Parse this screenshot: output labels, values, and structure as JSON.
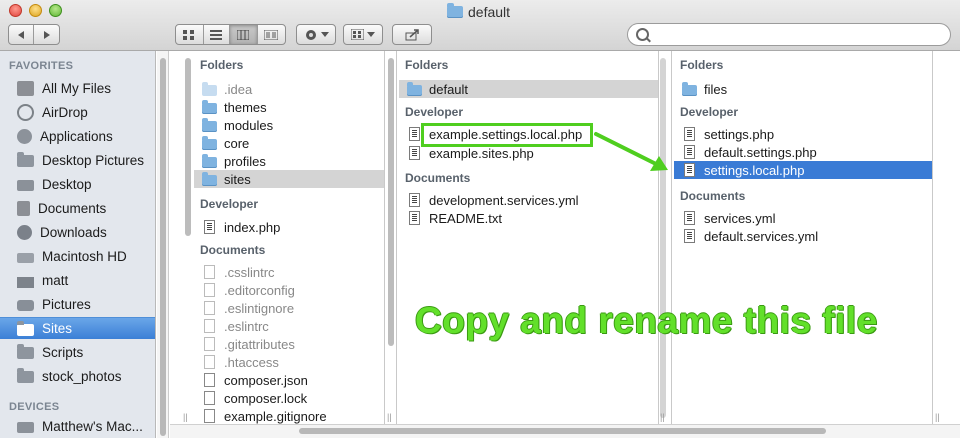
{
  "window": {
    "title": "default"
  },
  "toolbar": {
    "search_placeholder": "",
    "view_modes": [
      "icon-view",
      "list-view",
      "column-view",
      "cover-flow-view"
    ],
    "active_view": "column-view"
  },
  "sidebar": {
    "favorites_header": "FAVORITES",
    "devices_header": "DEVICES",
    "items": [
      {
        "label": "All My Files",
        "icon": "all-files-icon"
      },
      {
        "label": "AirDrop",
        "icon": "airdrop-icon"
      },
      {
        "label": "Applications",
        "icon": "applications-icon"
      },
      {
        "label": "Desktop Pictures",
        "icon": "folder-icon"
      },
      {
        "label": "Desktop",
        "icon": "desktop-icon"
      },
      {
        "label": "Documents",
        "icon": "documents-icon"
      },
      {
        "label": "Downloads",
        "icon": "downloads-icon"
      },
      {
        "label": "Macintosh HD",
        "icon": "hard-drive-icon"
      },
      {
        "label": "matt",
        "icon": "home-icon"
      },
      {
        "label": "Pictures",
        "icon": "camera-icon"
      },
      {
        "label": "Sites",
        "icon": "folder-icon"
      },
      {
        "label": "Scripts",
        "icon": "folder-icon"
      },
      {
        "label": "stock_photos",
        "icon": "folder-icon"
      }
    ],
    "selected": "Sites",
    "devices": [
      {
        "label": "Matthew's Mac...",
        "icon": "computer-icon"
      }
    ]
  },
  "columns": [
    {
      "groups": [
        {
          "header": "Folders",
          "items": [
            ".idea",
            "themes",
            "modules",
            "core",
            "profiles",
            "sites"
          ]
        },
        {
          "header": "Developer",
          "items": [
            "index.php"
          ]
        },
        {
          "header": "Documents",
          "items": [
            ".csslintrc",
            ".editorconfig",
            ".eslintignore",
            ".eslintrc",
            ".gitattributes",
            ".htaccess",
            "composer.json",
            "composer.lock",
            "example.gitignore"
          ]
        }
      ],
      "selected": "sites"
    },
    {
      "groups": [
        {
          "header": "Folders",
          "items": [
            "default"
          ]
        },
        {
          "header": "Developer",
          "items": [
            "example.settings.local.php",
            "example.sites.php"
          ]
        },
        {
          "header": "Documents",
          "items": [
            "development.services.yml",
            "README.txt"
          ]
        }
      ],
      "selected": "default"
    },
    {
      "groups": [
        {
          "header": "Folders",
          "items": [
            "files"
          ]
        },
        {
          "header": "Developer",
          "items": [
            "settings.php",
            "default.settings.php",
            "settings.local.php"
          ]
        },
        {
          "header": "Documents",
          "items": [
            "services.yml",
            "default.services.yml"
          ]
        }
      ],
      "selected": "settings.local.php"
    }
  ],
  "annotation": {
    "text": "Copy and rename this file",
    "color": "#5fdc24"
  }
}
